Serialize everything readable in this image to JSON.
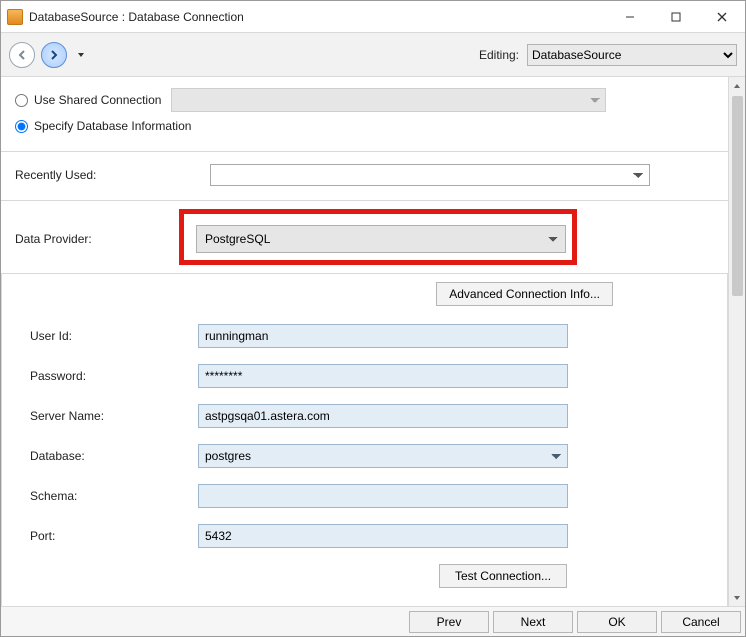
{
  "window": {
    "title": "DatabaseSource : Database Connection"
  },
  "toolbar": {
    "editing_label": "Editing:",
    "editing_value": "DatabaseSource"
  },
  "connection_mode": {
    "use_shared_label": "Use Shared Connection",
    "specify_label": "Specify Database Information",
    "selected": "specify"
  },
  "recently_used": {
    "label": "Recently Used:",
    "value": ""
  },
  "data_provider": {
    "label": "Data Provider:",
    "value": "PostgreSQL"
  },
  "advanced_button": "Advanced Connection Info...",
  "form": {
    "user_id": {
      "label": "User Id:",
      "value": "runningman"
    },
    "password": {
      "label": "Password:",
      "value": "********"
    },
    "server_name": {
      "label": "Server Name:",
      "value": "astpgsqa01.astera.com"
    },
    "database": {
      "label": "Database:",
      "value": "postgres"
    },
    "schema": {
      "label": "Schema:",
      "value": ""
    },
    "port": {
      "label": "Port:",
      "value": "5432"
    }
  },
  "test_button": "Test Connection...",
  "footer": {
    "prev": "Prev",
    "next": "Next",
    "ok": "OK",
    "cancel": "Cancel"
  }
}
